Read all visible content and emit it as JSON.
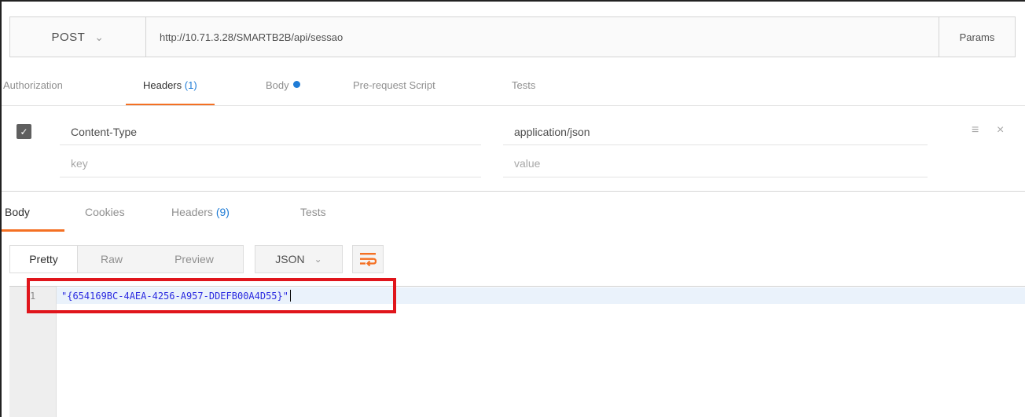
{
  "request": {
    "method": "POST",
    "url": "http://10.71.3.28/SMARTB2B/api/sessao",
    "params_label": "Params"
  },
  "request_tabs": [
    {
      "label": "Authorization",
      "count": "",
      "active": false
    },
    {
      "label": "Headers",
      "count": "(1)",
      "active": true
    },
    {
      "label": "Body",
      "count": "",
      "active": false,
      "dot": true
    },
    {
      "label": "Pre-request Script",
      "count": "",
      "active": false
    },
    {
      "label": "Tests",
      "count": "",
      "active": false
    }
  ],
  "headers": {
    "rows": [
      {
        "key": "Content-Type",
        "value": "application/json",
        "checked": true
      }
    ],
    "key_placeholder": "key",
    "value_placeholder": "value"
  },
  "response_tabs": [
    {
      "label": "Body",
      "count": "",
      "active": true
    },
    {
      "label": "Cookies",
      "count": "",
      "active": false
    },
    {
      "label": "Headers",
      "count": "(9)",
      "active": false
    },
    {
      "label": "Tests",
      "count": "",
      "active": false
    }
  ],
  "format": {
    "buttons": [
      "Pretty",
      "Raw",
      "Preview"
    ],
    "active": "Pretty",
    "language": "JSON"
  },
  "editor": {
    "lines": [
      {
        "number": "1",
        "text": "\"{654169BC-4AEA-4256-A957-DDEFB00A4D55}\""
      }
    ]
  },
  "colors": {
    "accent": "#f47023",
    "link": "#1f7cd6",
    "highlight": "#e0151b"
  }
}
